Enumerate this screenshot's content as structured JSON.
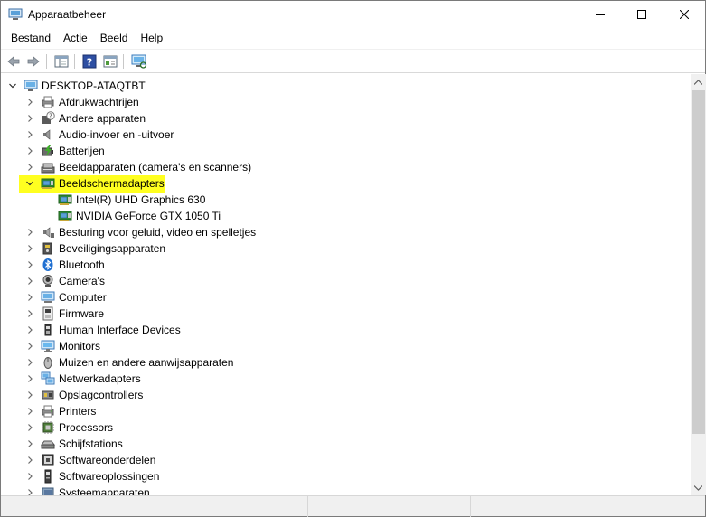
{
  "window": {
    "title": "Apparaatbeheer"
  },
  "menu": [
    "Bestand",
    "Actie",
    "Beeld",
    "Help"
  ],
  "tree": {
    "root": "DESKTOP-ATAQTBT",
    "items": [
      {
        "label": "Afdrukwachtrijen",
        "icon": "printer-queue-icon",
        "expanded": false
      },
      {
        "label": "Andere apparaten",
        "icon": "unknown-device-icon",
        "expanded": false
      },
      {
        "label": "Audio-invoer en -uitvoer",
        "icon": "speaker-icon",
        "expanded": false
      },
      {
        "label": "Batterijen",
        "icon": "battery-icon",
        "expanded": false
      },
      {
        "label": "Beeldapparaten (camera's en scanners)",
        "icon": "imaging-device-icon",
        "expanded": false
      },
      {
        "label": "Beeldschermadapters",
        "icon": "display-adapter-icon",
        "expanded": true,
        "selected": true,
        "children": [
          {
            "label": "Intel(R) UHD Graphics 630",
            "icon": "display-adapter-icon"
          },
          {
            "label": "NVIDIA GeForce GTX 1050 Ti",
            "icon": "display-adapter-icon"
          }
        ]
      },
      {
        "label": "Besturing voor geluid, video en spelletjes",
        "icon": "sound-video-icon",
        "expanded": false
      },
      {
        "label": "Beveiligingsapparaten",
        "icon": "security-device-icon",
        "expanded": false
      },
      {
        "label": "Bluetooth",
        "icon": "bluetooth-icon",
        "expanded": false
      },
      {
        "label": "Camera's",
        "icon": "camera-icon",
        "expanded": false
      },
      {
        "label": "Computer",
        "icon": "computer-icon",
        "expanded": false
      },
      {
        "label": "Firmware",
        "icon": "firmware-icon",
        "expanded": false
      },
      {
        "label": "Human Interface Devices",
        "icon": "hid-icon",
        "expanded": false
      },
      {
        "label": "Monitors",
        "icon": "monitor-icon",
        "expanded": false
      },
      {
        "label": "Muizen en andere aanwijsapparaten",
        "icon": "mouse-icon",
        "expanded": false
      },
      {
        "label": "Netwerkadapters",
        "icon": "network-adapter-icon",
        "expanded": false
      },
      {
        "label": "Opslagcontrollers",
        "icon": "storage-controller-icon",
        "expanded": false
      },
      {
        "label": "Printers",
        "icon": "printer-icon",
        "expanded": false
      },
      {
        "label": "Processors",
        "icon": "processor-icon",
        "expanded": false
      },
      {
        "label": "Schijfstations",
        "icon": "disk-drive-icon",
        "expanded": false
      },
      {
        "label": "Softwareonderdelen",
        "icon": "software-component-icon",
        "expanded": false
      },
      {
        "label": "Softwareoplossingen",
        "icon": "software-device-icon",
        "expanded": false
      },
      {
        "label": "Systeemapparaten",
        "icon": "system-device-icon",
        "expanded": false
      }
    ]
  },
  "colors": {
    "highlight": "#ffff20",
    "accent": "#0078d7"
  }
}
